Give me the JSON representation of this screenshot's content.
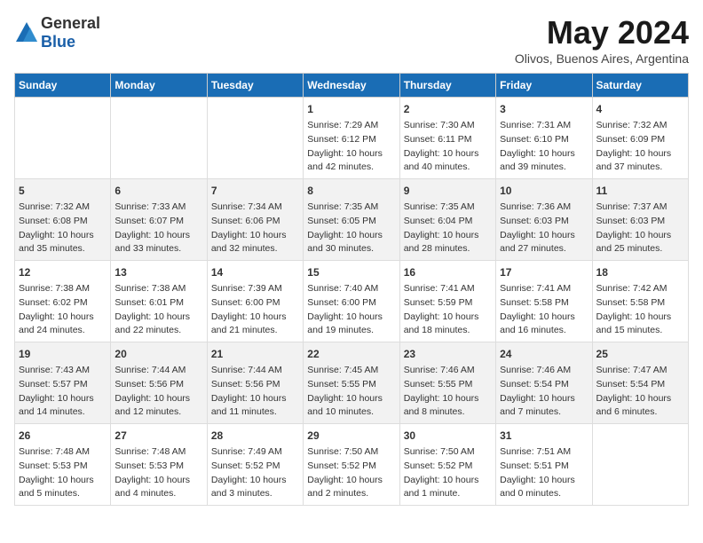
{
  "logo": {
    "text_general": "General",
    "text_blue": "Blue"
  },
  "title": "May 2024",
  "subtitle": "Olivos, Buenos Aires, Argentina",
  "days_of_week": [
    "Sunday",
    "Monday",
    "Tuesday",
    "Wednesday",
    "Thursday",
    "Friday",
    "Saturday"
  ],
  "weeks": [
    [
      {
        "day": "",
        "info": ""
      },
      {
        "day": "",
        "info": ""
      },
      {
        "day": "",
        "info": ""
      },
      {
        "day": "1",
        "info": "Sunrise: 7:29 AM\nSunset: 6:12 PM\nDaylight: 10 hours\nand 42 minutes."
      },
      {
        "day": "2",
        "info": "Sunrise: 7:30 AM\nSunset: 6:11 PM\nDaylight: 10 hours\nand 40 minutes."
      },
      {
        "day": "3",
        "info": "Sunrise: 7:31 AM\nSunset: 6:10 PM\nDaylight: 10 hours\nand 39 minutes."
      },
      {
        "day": "4",
        "info": "Sunrise: 7:32 AM\nSunset: 6:09 PM\nDaylight: 10 hours\nand 37 minutes."
      }
    ],
    [
      {
        "day": "5",
        "info": "Sunrise: 7:32 AM\nSunset: 6:08 PM\nDaylight: 10 hours\nand 35 minutes."
      },
      {
        "day": "6",
        "info": "Sunrise: 7:33 AM\nSunset: 6:07 PM\nDaylight: 10 hours\nand 33 minutes."
      },
      {
        "day": "7",
        "info": "Sunrise: 7:34 AM\nSunset: 6:06 PM\nDaylight: 10 hours\nand 32 minutes."
      },
      {
        "day": "8",
        "info": "Sunrise: 7:35 AM\nSunset: 6:05 PM\nDaylight: 10 hours\nand 30 minutes."
      },
      {
        "day": "9",
        "info": "Sunrise: 7:35 AM\nSunset: 6:04 PM\nDaylight: 10 hours\nand 28 minutes."
      },
      {
        "day": "10",
        "info": "Sunrise: 7:36 AM\nSunset: 6:03 PM\nDaylight: 10 hours\nand 27 minutes."
      },
      {
        "day": "11",
        "info": "Sunrise: 7:37 AM\nSunset: 6:03 PM\nDaylight: 10 hours\nand 25 minutes."
      }
    ],
    [
      {
        "day": "12",
        "info": "Sunrise: 7:38 AM\nSunset: 6:02 PM\nDaylight: 10 hours\nand 24 minutes."
      },
      {
        "day": "13",
        "info": "Sunrise: 7:38 AM\nSunset: 6:01 PM\nDaylight: 10 hours\nand 22 minutes."
      },
      {
        "day": "14",
        "info": "Sunrise: 7:39 AM\nSunset: 6:00 PM\nDaylight: 10 hours\nand 21 minutes."
      },
      {
        "day": "15",
        "info": "Sunrise: 7:40 AM\nSunset: 6:00 PM\nDaylight: 10 hours\nand 19 minutes."
      },
      {
        "day": "16",
        "info": "Sunrise: 7:41 AM\nSunset: 5:59 PM\nDaylight: 10 hours\nand 18 minutes."
      },
      {
        "day": "17",
        "info": "Sunrise: 7:41 AM\nSunset: 5:58 PM\nDaylight: 10 hours\nand 16 minutes."
      },
      {
        "day": "18",
        "info": "Sunrise: 7:42 AM\nSunset: 5:58 PM\nDaylight: 10 hours\nand 15 minutes."
      }
    ],
    [
      {
        "day": "19",
        "info": "Sunrise: 7:43 AM\nSunset: 5:57 PM\nDaylight: 10 hours\nand 14 minutes."
      },
      {
        "day": "20",
        "info": "Sunrise: 7:44 AM\nSunset: 5:56 PM\nDaylight: 10 hours\nand 12 minutes."
      },
      {
        "day": "21",
        "info": "Sunrise: 7:44 AM\nSunset: 5:56 PM\nDaylight: 10 hours\nand 11 minutes."
      },
      {
        "day": "22",
        "info": "Sunrise: 7:45 AM\nSunset: 5:55 PM\nDaylight: 10 hours\nand 10 minutes."
      },
      {
        "day": "23",
        "info": "Sunrise: 7:46 AM\nSunset: 5:55 PM\nDaylight: 10 hours\nand 8 minutes."
      },
      {
        "day": "24",
        "info": "Sunrise: 7:46 AM\nSunset: 5:54 PM\nDaylight: 10 hours\nand 7 minutes."
      },
      {
        "day": "25",
        "info": "Sunrise: 7:47 AM\nSunset: 5:54 PM\nDaylight: 10 hours\nand 6 minutes."
      }
    ],
    [
      {
        "day": "26",
        "info": "Sunrise: 7:48 AM\nSunset: 5:53 PM\nDaylight: 10 hours\nand 5 minutes."
      },
      {
        "day": "27",
        "info": "Sunrise: 7:48 AM\nSunset: 5:53 PM\nDaylight: 10 hours\nand 4 minutes."
      },
      {
        "day": "28",
        "info": "Sunrise: 7:49 AM\nSunset: 5:52 PM\nDaylight: 10 hours\nand 3 minutes."
      },
      {
        "day": "29",
        "info": "Sunrise: 7:50 AM\nSunset: 5:52 PM\nDaylight: 10 hours\nand 2 minutes."
      },
      {
        "day": "30",
        "info": "Sunrise: 7:50 AM\nSunset: 5:52 PM\nDaylight: 10 hours\nand 1 minute."
      },
      {
        "day": "31",
        "info": "Sunrise: 7:51 AM\nSunset: 5:51 PM\nDaylight: 10 hours\nand 0 minutes."
      },
      {
        "day": "",
        "info": ""
      }
    ]
  ]
}
